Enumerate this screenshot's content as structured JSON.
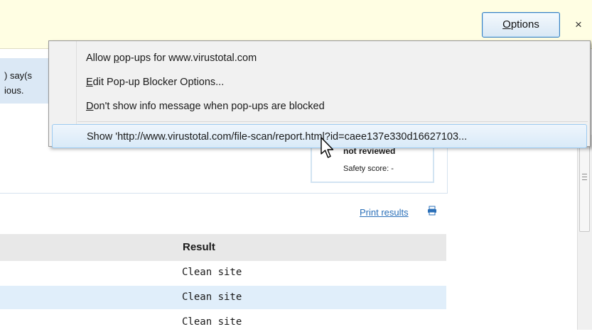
{
  "infobar": {
    "options_button": {
      "prefix": "",
      "accel": "O",
      "suffix": "ptions"
    },
    "close_glyph": "×"
  },
  "menu": {
    "items": [
      {
        "before": "Allow ",
        "accel": "p",
        "after": "op-ups for www.virustotal.com"
      },
      {
        "before": "",
        "accel": "E",
        "after": "dit Pop-up Blocker Options..."
      },
      {
        "before": "",
        "accel": "D",
        "after": "on't show info message when pop-ups are blocked"
      },
      {
        "before": "Show 'http://www.virustotal.com/file-scan/report.html?id=caee137e330d16627103...",
        "accel": "",
        "after": ""
      }
    ]
  },
  "page": {
    "left_snippet_lines": [
      ") say(s",
      "ious."
    ],
    "score_box": {
      "status": "not reviewed",
      "safety_score": "Safety score: -"
    },
    "print_results": "Print results",
    "table": {
      "header": "Result",
      "rows": [
        "Clean site",
        "Clean site",
        "Clean site"
      ]
    }
  },
  "icons": {
    "printer": "printer-icon",
    "cursor": "mouse-pointer-icon",
    "close": "close-icon"
  },
  "colors": {
    "infobar_bg": "#fffee3",
    "link": "#2a6fb8",
    "alt_row": "#e0eefa",
    "menu_hover_border": "#9ccaf0"
  }
}
